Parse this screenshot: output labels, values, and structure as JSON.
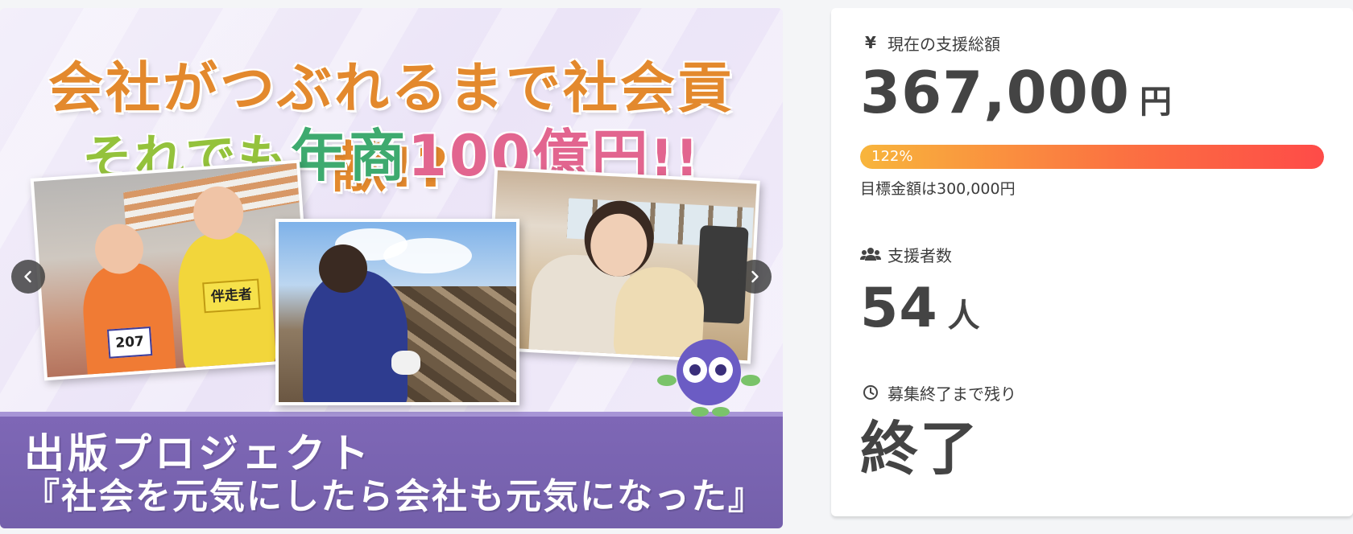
{
  "hero": {
    "headline_line1": "会社がつぶれるまで社会貢献!?",
    "headline_line2_a": "それでも",
    "headline_line2_b": "年商",
    "headline_line2_c": "100億円",
    "headline_line2_d": "!!",
    "bib_number": "207",
    "bib_guide": "伴走者",
    "banner_line1": "出版プロジェクト",
    "banner_line2": "『社会を元気にしたら会社も元気になった』",
    "prev_icon": "chevron-left-icon",
    "next_icon": "chevron-right-icon"
  },
  "stats": {
    "total_label": "現在の支援総額",
    "total_amount": "367,000",
    "total_unit": "円",
    "progress_text": "122%",
    "progress_percent": 122,
    "goal_text": "目標金額は300,000円",
    "backers_label": "支援者数",
    "backers_count": "54",
    "backers_unit": "人",
    "remaining_label": "募集終了まで残り",
    "remaining_value": "終了"
  },
  "colors": {
    "banner": "#7e67b6",
    "progress_start": "#f8b53c",
    "progress_end": "#fe4b48",
    "headline_orange": "#e3892d",
    "headline_green": "#3eaa6f",
    "headline_pink": "#e2658f"
  }
}
